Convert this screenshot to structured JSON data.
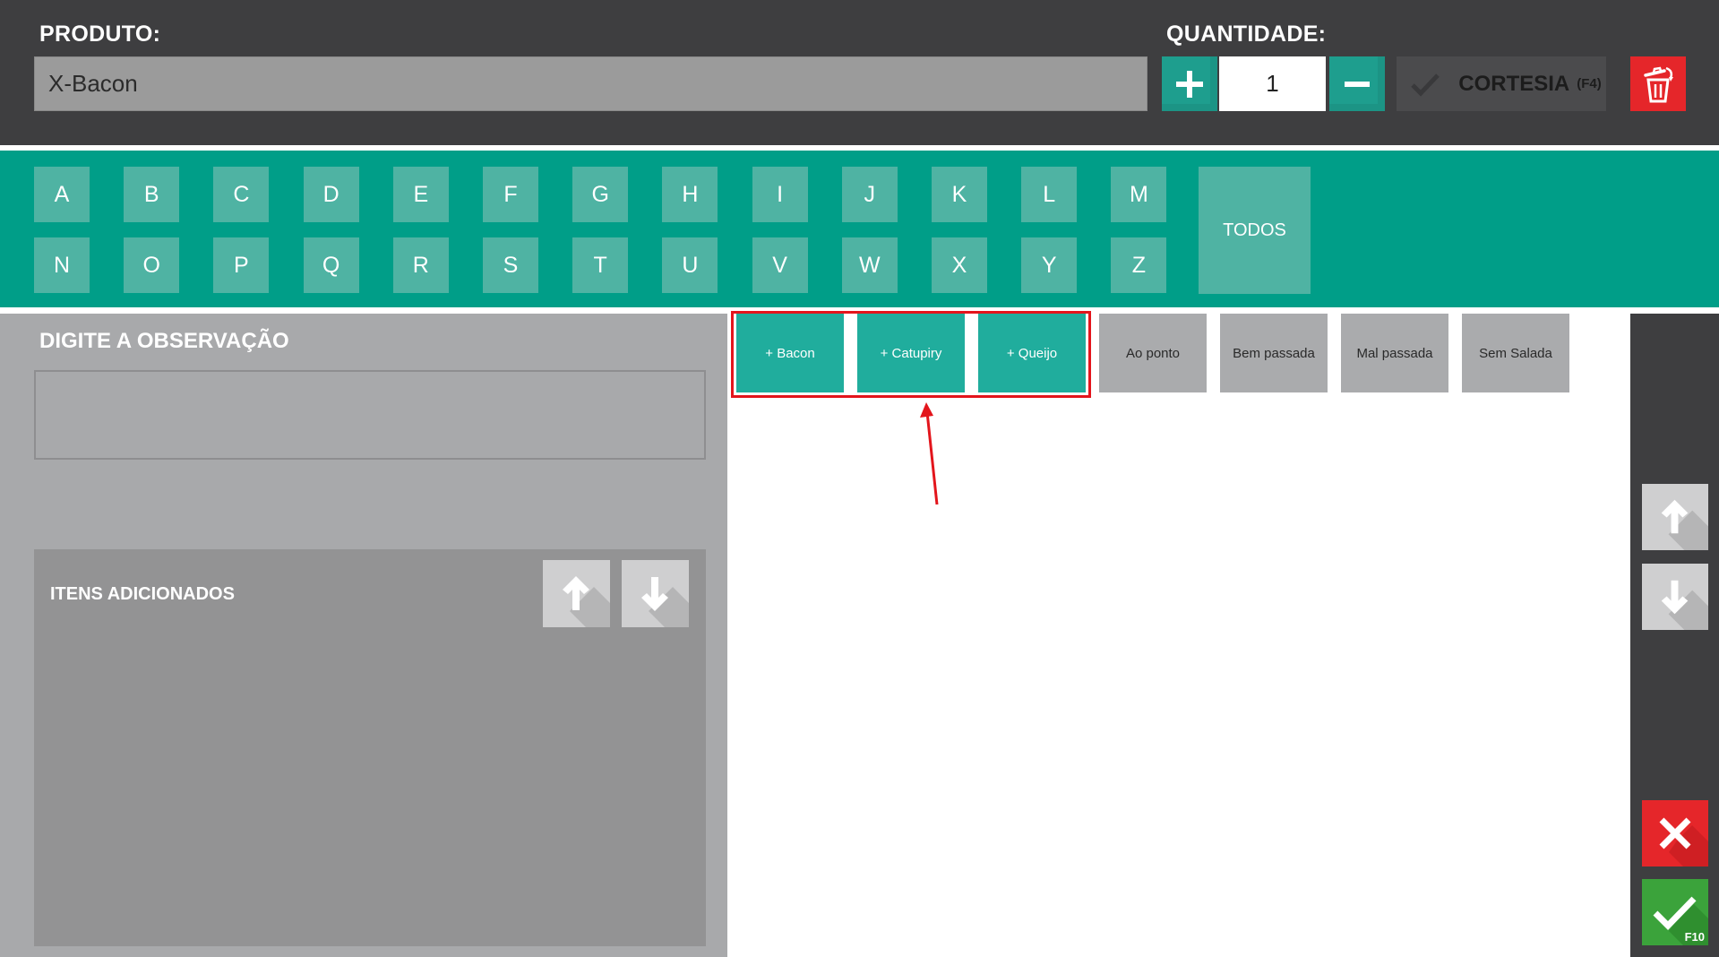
{
  "header": {
    "product_label": "PRODUTO:",
    "product_value": "X-Bacon",
    "quantity_label": "QUANTIDADE:",
    "quantity_value": "1",
    "cortesia_label": "CORTESIA",
    "cortesia_shortcut": "(F4)"
  },
  "letters": [
    "A",
    "B",
    "C",
    "D",
    "E",
    "F",
    "G",
    "H",
    "I",
    "J",
    "K",
    "L",
    "M",
    "N",
    "O",
    "P",
    "Q",
    "R",
    "S",
    "T",
    "U",
    "V",
    "W",
    "X",
    "Y",
    "Z"
  ],
  "todos_label": "TODOS",
  "observation": {
    "title": "DIGITE A OBSERVAÇÃO",
    "value": ""
  },
  "added_items": {
    "title": "ITENS ADICIONADOS",
    "items": []
  },
  "options": [
    {
      "label": "+ Bacon",
      "style": "green"
    },
    {
      "label": "+ Catupiry",
      "style": "green"
    },
    {
      "label": "+ Queijo",
      "style": "green"
    },
    {
      "label": "Ao ponto",
      "style": "gray"
    },
    {
      "label": "Bem passada",
      "style": "gray"
    },
    {
      "label": "Mal passada",
      "style": "gray"
    },
    {
      "label": "Sem Salada",
      "style": "gray"
    }
  ],
  "footer": {
    "confirm_shortcut": "F10"
  },
  "colors": {
    "dark_bar": "#3e3e40",
    "teal_bar": "#009e88",
    "teal_button": "#1e9e8e",
    "letter_button": "#4fb3a3",
    "danger_red": "#e5262a",
    "confirm_green": "#3ba33b",
    "highlight_red": "#e3151c"
  },
  "icons": {
    "plus": "plus-icon",
    "minus": "minus-icon",
    "checkmark": "checkmark-icon",
    "trash": "trash-icon",
    "arrow_up": "arrow-up-icon",
    "arrow_down": "arrow-down-icon",
    "close": "close-icon"
  }
}
